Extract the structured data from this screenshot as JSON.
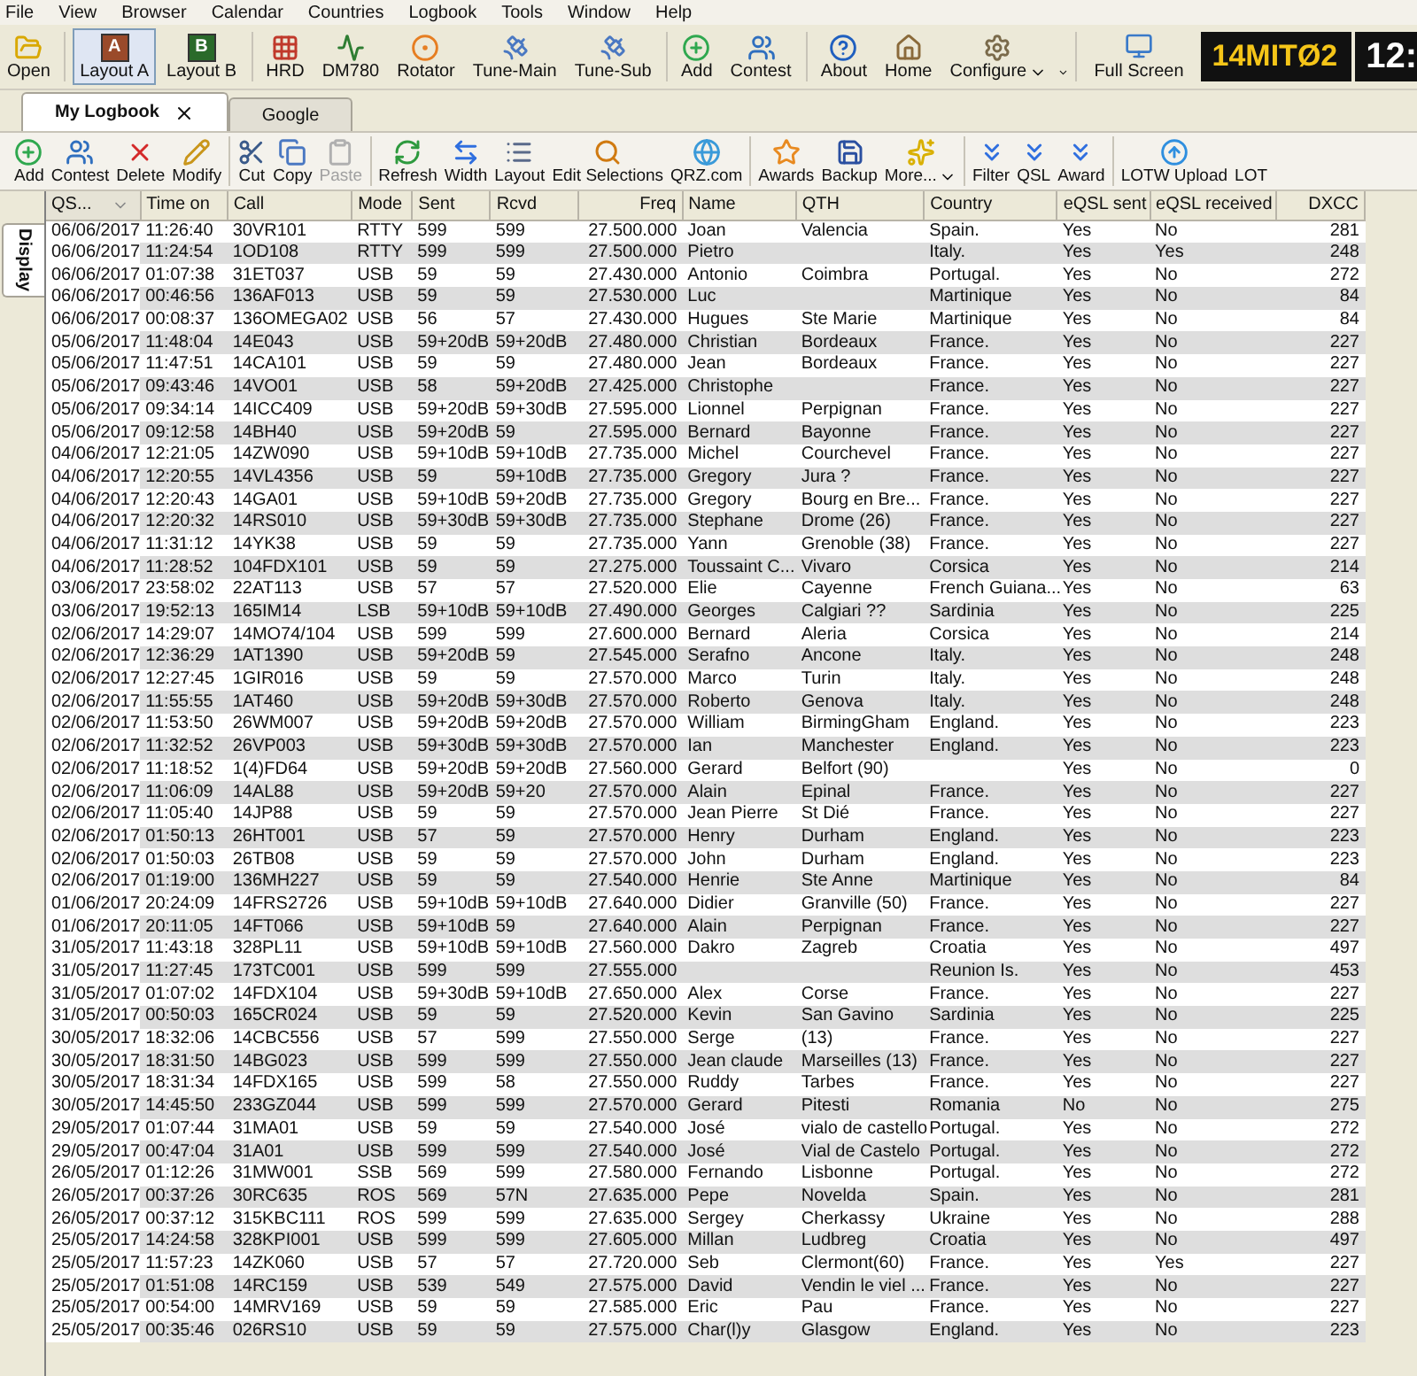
{
  "menu": [
    "File",
    "View",
    "Browser",
    "Calendar",
    "Countries",
    "Logbook",
    "Tools",
    "Window",
    "Help"
  ],
  "main_toolbar": {
    "groups": [
      [
        {
          "label": "Open",
          "selected": false,
          "menu": false
        }
      ],
      [
        {
          "label": "Layout A",
          "selected": true,
          "menu": false,
          "icon_letter": "A"
        },
        {
          "label": "Layout B",
          "selected": false,
          "menu": false,
          "icon_letter": "B"
        }
      ],
      [
        {
          "label": "HRD",
          "selected": false,
          "menu": false
        },
        {
          "label": "DM780",
          "selected": false,
          "menu": false
        },
        {
          "label": "Rotator",
          "selected": false,
          "menu": false
        },
        {
          "label": "Tune-Main",
          "selected": false,
          "menu": false
        },
        {
          "label": "Tune-Sub",
          "selected": false,
          "menu": false
        }
      ],
      [
        {
          "label": "Add",
          "selected": false,
          "menu": false
        },
        {
          "label": "Contest",
          "selected": false,
          "menu": false
        }
      ],
      [
        {
          "label": "About",
          "selected": false,
          "menu": false
        },
        {
          "label": "Home",
          "selected": false,
          "menu": false
        },
        {
          "label": "Configure",
          "selected": false,
          "menu": true
        }
      ]
    ],
    "fullscreen": "Full Screen",
    "frequency_display": "14MITØ2",
    "clock": "12:"
  },
  "tabs": [
    {
      "label": "My Logbook",
      "selected": true,
      "closable": true
    },
    {
      "label": "Google",
      "selected": false,
      "closable": false
    }
  ],
  "log_toolbar": {
    "groups": [
      [
        {
          "label": "Add",
          "disabled": false,
          "menu": false
        },
        {
          "label": "Contest",
          "disabled": false,
          "menu": false
        },
        {
          "label": "Delete",
          "disabled": false,
          "menu": false
        },
        {
          "label": "Modify",
          "disabled": false,
          "menu": false
        }
      ],
      [
        {
          "label": "Cut",
          "disabled": false,
          "menu": false
        },
        {
          "label": "Copy",
          "disabled": false,
          "menu": false
        },
        {
          "label": "Paste",
          "disabled": true,
          "menu": false
        }
      ],
      [
        {
          "label": "Refresh",
          "disabled": false,
          "menu": false
        },
        {
          "label": "Width",
          "disabled": false,
          "menu": false
        },
        {
          "label": "Layout",
          "disabled": false,
          "menu": false
        },
        {
          "label": "Edit Selections",
          "disabled": false,
          "menu": false
        },
        {
          "label": "QRZ.com",
          "disabled": false,
          "menu": false
        }
      ],
      [
        {
          "label": "Awards",
          "disabled": false,
          "menu": false
        },
        {
          "label": "Backup",
          "disabled": false,
          "menu": false
        },
        {
          "label": "More...",
          "disabled": false,
          "menu": true
        }
      ],
      [
        {
          "label": "Filter",
          "disabled": false,
          "menu": false
        },
        {
          "label": "QSL",
          "disabled": false,
          "menu": false
        },
        {
          "label": "Award",
          "disabled": false,
          "menu": false
        }
      ],
      [
        {
          "label": "LOTW Upload",
          "disabled": false,
          "menu": false
        },
        {
          "label": "LOT",
          "disabled": false,
          "menu": false
        }
      ]
    ]
  },
  "side_tab": "Display",
  "table": {
    "columns": [
      {
        "label": "QS...",
        "sorted": true
      },
      {
        "label": "Time on",
        "sorted": false
      },
      {
        "label": "Call",
        "sorted": false
      },
      {
        "label": "Mode",
        "sorted": false
      },
      {
        "label": "Sent",
        "sorted": false
      },
      {
        "label": "Rcvd",
        "sorted": false
      },
      {
        "label": "Freq",
        "sorted": false
      },
      {
        "label": "Name",
        "sorted": false
      },
      {
        "label": "QTH",
        "sorted": false
      },
      {
        "label": "Country",
        "sorted": false
      },
      {
        "label": "eQSL sent",
        "sorted": false
      },
      {
        "label": "eQSL received",
        "sorted": false
      },
      {
        "label": "DXCC",
        "sorted": false
      }
    ],
    "rows": [
      [
        "06/06/2017",
        "11:26:40",
        "30VR101",
        "RTTY",
        "599",
        "599",
        "27.500.000",
        "Joan",
        "Valencia",
        "Spain.",
        "Yes",
        "No",
        "281"
      ],
      [
        "06/06/2017",
        "11:24:54",
        "1OD108",
        "RTTY",
        "599",
        "599",
        "27.500.000",
        "Pietro",
        "",
        "Italy.",
        "Yes",
        "Yes",
        "248"
      ],
      [
        "06/06/2017",
        "01:07:38",
        "31ET037",
        "USB",
        "59",
        "59",
        "27.430.000",
        "Antonio",
        "Coimbra",
        "Portugal.",
        "Yes",
        "No",
        "272"
      ],
      [
        "06/06/2017",
        "00:46:56",
        "136AF013",
        "USB",
        "59",
        "59",
        "27.530.000",
        "Luc",
        "",
        "Martinique",
        "Yes",
        "No",
        "84"
      ],
      [
        "06/06/2017",
        "00:08:37",
        "136OMEGA02",
        "USB",
        "56",
        "57",
        "27.430.000",
        "Hugues",
        "Ste Marie",
        "Martinique",
        "Yes",
        "No",
        "84"
      ],
      [
        "05/06/2017",
        "11:48:04",
        "14E043",
        "USB",
        "59+20dB",
        "59+20dB",
        "27.480.000",
        "Christian",
        "Bordeaux",
        "France.",
        "Yes",
        "No",
        "227"
      ],
      [
        "05/06/2017",
        "11:47:51",
        "14CA101",
        "USB",
        "59",
        "59",
        "27.480.000",
        "Jean",
        "Bordeaux",
        "France.",
        "Yes",
        "No",
        "227"
      ],
      [
        "05/06/2017",
        "09:43:46",
        "14VO01",
        "USB",
        "58",
        "59+20dB",
        "27.425.000",
        "Christophe",
        "",
        "France.",
        "Yes",
        "No",
        "227"
      ],
      [
        "05/06/2017",
        "09:34:14",
        "14ICC409",
        "USB",
        "59+20dB",
        "59+30dB",
        "27.595.000",
        "Lionnel",
        "Perpignan",
        "France.",
        "Yes",
        "No",
        "227"
      ],
      [
        "05/06/2017",
        "09:12:58",
        "14BH40",
        "USB",
        "59+20dB",
        "59",
        "27.595.000",
        "Bernard",
        "Bayonne",
        "France.",
        "Yes",
        "No",
        "227"
      ],
      [
        "04/06/2017",
        "12:21:05",
        "14ZW090",
        "USB",
        "59+10dB",
        "59+10dB",
        "27.735.000",
        "Michel",
        "Courchevel",
        "France.",
        "Yes",
        "No",
        "227"
      ],
      [
        "04/06/2017",
        "12:20:55",
        "14VL4356",
        "USB",
        "59",
        "59+10dB",
        "27.735.000",
        "Gregory",
        "Jura ?",
        "France.",
        "Yes",
        "No",
        "227"
      ],
      [
        "04/06/2017",
        "12:20:43",
        "14GA01",
        "USB",
        "59+10dB",
        "59+20dB",
        "27.735.000",
        "Gregory",
        "Bourg en Bre...",
        "France.",
        "Yes",
        "No",
        "227"
      ],
      [
        "04/06/2017",
        "12:20:32",
        "14RS010",
        "USB",
        "59+30dB",
        "59+30dB",
        "27.735.000",
        "Stephane",
        "Drome (26)",
        "France.",
        "Yes",
        "No",
        "227"
      ],
      [
        "04/06/2017",
        "11:31:12",
        "14YK38",
        "USB",
        "59",
        "59",
        "27.735.000",
        "Yann",
        "Grenoble (38)",
        "France.",
        "Yes",
        "No",
        "227"
      ],
      [
        "04/06/2017",
        "11:28:52",
        "104FDX101",
        "USB",
        "59",
        "59",
        "27.275.000",
        "Toussaint C...",
        "Vivaro",
        "Corsica",
        "Yes",
        "No",
        "214"
      ],
      [
        "03/06/2017",
        "23:58:02",
        "22AT113",
        "USB",
        "57",
        "57",
        "27.520.000",
        "Elie",
        "Cayenne",
        "French Guiana...",
        "Yes",
        "No",
        "63"
      ],
      [
        "03/06/2017",
        "19:52:13",
        "165IM14",
        "LSB",
        "59+10dB",
        "59+10dB",
        "27.490.000",
        "Georges",
        "Calgiari ??",
        "Sardinia",
        "Yes",
        "No",
        "225"
      ],
      [
        "02/06/2017",
        "14:29:07",
        "14MO74/104",
        "USB",
        "599",
        "599",
        "27.600.000",
        "Bernard",
        "Aleria",
        "Corsica",
        "Yes",
        "No",
        "214"
      ],
      [
        "02/06/2017",
        "12:36:29",
        "1AT1390",
        "USB",
        "59+20dB",
        "59",
        "27.545.000",
        "Serafno",
        "Ancone",
        "Italy.",
        "Yes",
        "No",
        "248"
      ],
      [
        "02/06/2017",
        "12:27:45",
        "1GIR016",
        "USB",
        "59",
        "59",
        "27.570.000",
        "Marco",
        "Turin",
        "Italy.",
        "Yes",
        "No",
        "248"
      ],
      [
        "02/06/2017",
        "11:55:55",
        "1AT460",
        "USB",
        "59+20dB",
        "59+30dB",
        "27.570.000",
        "Roberto",
        "Genova",
        "Italy.",
        "Yes",
        "No",
        "248"
      ],
      [
        "02/06/2017",
        "11:53:50",
        "26WM007",
        "USB",
        "59+20dB",
        "59+20dB",
        "27.570.000",
        "William",
        "BirmingGham",
        "England.",
        "Yes",
        "No",
        "223"
      ],
      [
        "02/06/2017",
        "11:32:52",
        "26VP003",
        "USB",
        "59+30dB",
        "59+30dB",
        "27.570.000",
        "Ian",
        "Manchester",
        "England.",
        "Yes",
        "No",
        "223"
      ],
      [
        "02/06/2017",
        "11:18:52",
        "1(4)FD64",
        "USB",
        "59+20dB",
        "59+20dB",
        "27.560.000",
        "Gerard",
        "Belfort (90)",
        "",
        "Yes",
        "No",
        "0"
      ],
      [
        "02/06/2017",
        "11:06:09",
        "14AL88",
        "USB",
        "59+20dB",
        "59+20",
        "27.570.000",
        "Alain",
        "Epinal",
        "France.",
        "Yes",
        "No",
        "227"
      ],
      [
        "02/06/2017",
        "11:05:40",
        "14JP88",
        "USB",
        "59",
        "59",
        "27.570.000",
        "Jean Pierre",
        "St Dié",
        "France.",
        "Yes",
        "No",
        "227"
      ],
      [
        "02/06/2017",
        "01:50:13",
        "26HT001",
        "USB",
        "57",
        "59",
        "27.570.000",
        "Henry",
        "Durham",
        "England.",
        "Yes",
        "No",
        "223"
      ],
      [
        "02/06/2017",
        "01:50:03",
        "26TB08",
        "USB",
        "59",
        "59",
        "27.570.000",
        "John",
        "Durham",
        "England.",
        "Yes",
        "No",
        "223"
      ],
      [
        "02/06/2017",
        "01:19:00",
        "136MH227",
        "USB",
        "59",
        "59",
        "27.540.000",
        "Henrie",
        "Ste Anne",
        "Martinique",
        "Yes",
        "No",
        "84"
      ],
      [
        "01/06/2017",
        "20:24:09",
        "14FRS2726",
        "USB",
        "59+10dB",
        "59+10dB",
        "27.640.000",
        "Didier",
        "Granville (50)",
        "France.",
        "Yes",
        "No",
        "227"
      ],
      [
        "01/06/2017",
        "20:11:05",
        "14FT066",
        "USB",
        "59+10dB",
        "59",
        "27.640.000",
        "Alain",
        "Perpignan",
        "France.",
        "Yes",
        "No",
        "227"
      ],
      [
        "31/05/2017",
        "11:43:18",
        "328PL11",
        "USB",
        "59+10dB",
        "59+10dB",
        "27.560.000",
        "Dakro",
        "Zagreb",
        "Croatia",
        "Yes",
        "No",
        "497"
      ],
      [
        "31/05/2017",
        "11:27:45",
        "173TC001",
        "USB",
        "599",
        "599",
        "27.555.000",
        "",
        "",
        "Reunion Is.",
        "Yes",
        "No",
        "453"
      ],
      [
        "31/05/2017",
        "01:07:02",
        "14FDX104",
        "USB",
        "59+30dB",
        "59+10dB",
        "27.650.000",
        "Alex",
        "Corse",
        "France.",
        "Yes",
        "No",
        "227"
      ],
      [
        "31/05/2017",
        "00:50:03",
        "165CR024",
        "USB",
        "59",
        "59",
        "27.520.000",
        "Kevin",
        "San Gavino",
        "Sardinia",
        "Yes",
        "No",
        "225"
      ],
      [
        "30/05/2017",
        "18:32:06",
        "14CBC556",
        "USB",
        "57",
        "599",
        "27.550.000",
        "Serge",
        "(13)",
        "France.",
        "Yes",
        "No",
        "227"
      ],
      [
        "30/05/2017",
        "18:31:50",
        "14BG023",
        "USB",
        "599",
        "599",
        "27.550.000",
        "Jean claude",
        "Marseilles (13)",
        "France.",
        "Yes",
        "No",
        "227"
      ],
      [
        "30/05/2017",
        "18:31:34",
        "14FDX165",
        "USB",
        "599",
        "58",
        "27.550.000",
        "Ruddy",
        "Tarbes",
        "France.",
        "Yes",
        "No",
        "227"
      ],
      [
        "30/05/2017",
        "14:45:50",
        "233GZ044",
        "USB",
        "599",
        "599",
        "27.570.000",
        "Gerard",
        "Pitesti",
        "Romania",
        "No",
        "No",
        "275"
      ],
      [
        "29/05/2017",
        "01:07:44",
        "31MA01",
        "USB",
        "59",
        "59",
        "27.540.000",
        "José",
        "vialo de castello",
        "Portugal.",
        "Yes",
        "No",
        "272"
      ],
      [
        "29/05/2017",
        "00:47:04",
        "31A01",
        "USB",
        "599",
        "599",
        "27.540.000",
        "José",
        "Vial de Castelo",
        "Portugal.",
        "Yes",
        "No",
        "272"
      ],
      [
        "26/05/2017",
        "01:12:26",
        "31MW001",
        "SSB",
        "569",
        "599",
        "27.580.000",
        "Fernando",
        "Lisbonne",
        "Portugal.",
        "Yes",
        "No",
        "272"
      ],
      [
        "26/05/2017",
        "00:37:26",
        "30RC635",
        "ROS",
        "569",
        "57N",
        "27.635.000",
        "Pepe",
        "Novelda",
        "Spain.",
        "Yes",
        "No",
        "281"
      ],
      [
        "26/05/2017",
        "00:37:12",
        "315KBC111",
        "ROS",
        "599",
        "599",
        "27.635.000",
        "Sergey",
        "Cherkassy",
        "Ukraine",
        "Yes",
        "No",
        "288"
      ],
      [
        "25/05/2017",
        "14:24:58",
        "328KPI001",
        "USB",
        "599",
        "599",
        "27.605.000",
        "Millan",
        "Ludbreg",
        "Croatia",
        "Yes",
        "No",
        "497"
      ],
      [
        "25/05/2017",
        "11:57:23",
        "14ZK060",
        "USB",
        "57",
        "57",
        "27.720.000",
        "Seb",
        "Clermont(60)",
        "France.",
        "Yes",
        "Yes",
        "227"
      ],
      [
        "25/05/2017",
        "01:51:08",
        "14RC159",
        "USB",
        "539",
        "549",
        "27.575.000",
        "David",
        "Vendin le viel ...",
        "France.",
        "Yes",
        "No",
        "227"
      ],
      [
        "25/05/2017",
        "00:54:00",
        "14MRV169",
        "USB",
        "59",
        "59",
        "27.585.000",
        "Eric",
        "Pau",
        "France.",
        "Yes",
        "No",
        "227"
      ],
      [
        "25/05/2017",
        "00:35:46",
        "026RS10",
        "USB",
        "59",
        "59",
        "27.575.000",
        "Char(l)y",
        "Glasgow",
        "England.",
        "Yes",
        "No",
        "223"
      ]
    ]
  }
}
